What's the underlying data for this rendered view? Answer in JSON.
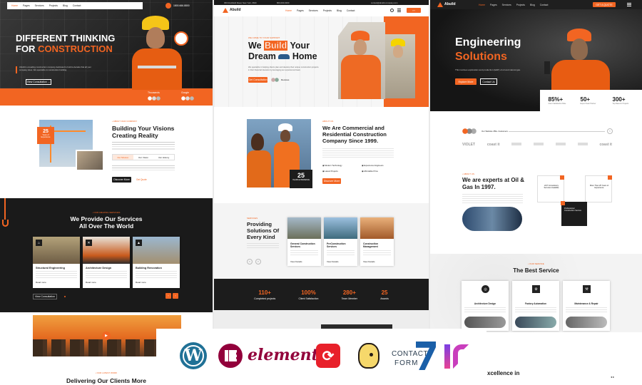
{
  "brand": "Abuild",
  "nav": [
    "Home",
    "Pages",
    "Services",
    "Projects",
    "Blog",
    "Contact"
  ],
  "col1": {
    "phone": "1800.666.8800",
    "hero_line1": "DIFFERENT THINKING",
    "hero_for": "FOR",
    "hero_accent": "CONSTRUCTION",
    "hero_desc": "Abuild is a leading construction company dedicated to build a decade that all your company does. We specialize in construction building.",
    "hero_btn": "View Consultation →",
    "tag1": "Thousands",
    "tag2": "Google",
    "about_sub": "• ABOUT OUR COMPANY",
    "about_title1": "Building Your Visions",
    "about_title2": "Creating Reality",
    "badge_num": "25",
    "badge_text": "Years of Experience",
    "tabs": [
      "Our Mission",
      "Our Vision",
      "Our History"
    ],
    "about_btn": "Discover More",
    "about_link": "Get Quote",
    "svc_sub": "• OUR AMAZING SERVICES",
    "svc_title1": "We Provide Our Services",
    "svc_title2": "All Over The World",
    "cards": [
      {
        "t": "Structural Engineering",
        "more": "Read more"
      },
      {
        "t": "Architecture Design",
        "more": "Read more"
      },
      {
        "t": "Building Renovation",
        "more": "Read more"
      }
    ],
    "view_btn": "View Consultation",
    "client_sub": "• OUR LATEST WORK",
    "client_title": "Delivering Our Clients More"
  },
  "col2": {
    "contact1": "360 Rockfield Road, New York, 0600",
    "contact2": "800-000-0000",
    "contact3": "contact@abuild-company.com",
    "hero_sub": "WE COME TO YOUR SUPPORT",
    "hero_we": "We",
    "hero_build": "Build",
    "hero_your": "Your",
    "hero_dream": "Dream",
    "hero_home": "Home",
    "hero_desc": "We specialize in helping clients plan and develop their unique construction projects in their financial interests by leveraging our experienced team.",
    "hero_btn": "Get Consultation",
    "hero_reviews": "Reviews",
    "about_sub": "ABOUT US",
    "about_title1": "We Are Commercial and",
    "about_title2": "Residential Construction",
    "about_title3": "Company Since 1999.",
    "badge_num": "25",
    "badge_text": "YEARS EXPERIENCE",
    "features": [
      "Modern Technology",
      "Experience Engineers",
      "Latest Projects",
      "Affordable Price"
    ],
    "about_btn": "Discover More",
    "svc_sub": "SERVICES",
    "svc_title1": "Providing",
    "svc_title2": "Solutions Of",
    "svc_title3": "Every Kind",
    "cards": [
      {
        "t": "General Construction Services",
        "more": "View Details"
      },
      {
        "t": "PreConstruction Services",
        "more": "View Details"
      },
      {
        "t": "Construction Management",
        "more": "View Details"
      }
    ],
    "stats": [
      {
        "n": "110+",
        "l": "Completed projects"
      },
      {
        "n": "100%",
        "l": "Client Satisfaction"
      },
      {
        "n": "280+",
        "l": "Team Member"
      },
      {
        "n": "25",
        "l": "Awards"
      }
    ]
  },
  "col3": {
    "hero_title1": "Engineering",
    "hero_title2": "Solutions",
    "hero_desc": "This involves exploration and production (E&P) of oil and natural gas.",
    "btn1": "Explore More",
    "btn2": "Contact Us",
    "cta": "GET A QUOTE",
    "stats": [
      {
        "n": "85%+",
        "l": "Client Satisfaction Rate"
      },
      {
        "n": "50+",
        "l": "Expert Team Partner"
      },
      {
        "n": "300+",
        "l": "Top Rated in Projects"
      }
    ],
    "clients_text": "Our Website 450+ Customers",
    "brands": [
      "VIOLET",
      "coast it",
      "",
      "",
      "",
      "",
      "coast it"
    ],
    "about_sub": "• ABOUT US",
    "about_title1": "We are experts at Oil &",
    "about_title2": "Gas In 1997.",
    "box1": "24/7 Consultancy Services Available",
    "box2": "More Than 25 Years of Experience",
    "box3": "Professional Construction Service",
    "svc_sub": "• OUR SERVICE",
    "svc_title": "The Best Service",
    "cards": [
      {
        "t": "Architecture Design"
      },
      {
        "t": "Factory Automation"
      },
      {
        "t": "Maintenance & Repair"
      }
    ],
    "bottom_text": "xcellence in"
  },
  "logos": {
    "elementor": "elementor",
    "contact": "CONTACT",
    "form": "FORM"
  },
  "colors": {
    "accent": "#f26522",
    "dark": "#1c1c1c"
  }
}
